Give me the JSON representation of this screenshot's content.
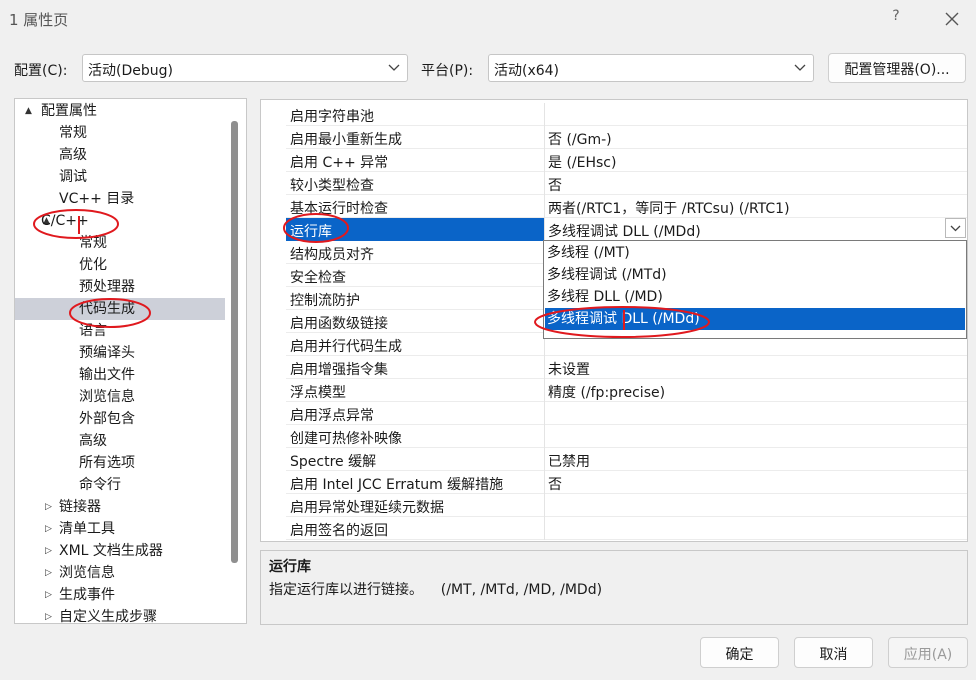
{
  "window": {
    "title": "1 属性页",
    "help": "?"
  },
  "config": {
    "label": "配置(C):",
    "value": "活动(Debug)"
  },
  "platform": {
    "label": "平台(P):",
    "value": "活动(x64)"
  },
  "config_manager_label": "配置管理器(O)...",
  "tree": [
    {
      "label": "配置属性",
      "expander": "▲"
    },
    {
      "label": "常规"
    },
    {
      "label": "高级"
    },
    {
      "label": "调试"
    },
    {
      "label": "VC++ 目录"
    },
    {
      "label": "C/C++",
      "expander": "▲"
    },
    {
      "label": "常规"
    },
    {
      "label": "优化"
    },
    {
      "label": "预处理器"
    },
    {
      "label": "代码生成",
      "selected": true
    },
    {
      "label": "语言"
    },
    {
      "label": "预编译头"
    },
    {
      "label": "输出文件"
    },
    {
      "label": "浏览信息"
    },
    {
      "label": "外部包含"
    },
    {
      "label": "高级"
    },
    {
      "label": "所有选项"
    },
    {
      "label": "命令行"
    },
    {
      "label": "链接器",
      "expander": "▷"
    },
    {
      "label": "清单工具",
      "expander": "▷"
    },
    {
      "label": "XML 文档生成器",
      "expander": "▷"
    },
    {
      "label": "浏览信息",
      "expander": "▷"
    },
    {
      "label": "生成事件",
      "expander": "▷"
    },
    {
      "label": "自定义生成步骤",
      "expander": "▷"
    }
  ],
  "properties": [
    {
      "name": "启用字符串池",
      "value": ""
    },
    {
      "name": "启用最小重新生成",
      "value": "否 (/Gm-)"
    },
    {
      "name": "启用 C++ 异常",
      "value": "是 (/EHsc)"
    },
    {
      "name": "较小类型检查",
      "value": "否"
    },
    {
      "name": "基本运行时检查",
      "value": "两者(/RTC1，等同于 /RTCsu) (/RTC1)"
    },
    {
      "name": "运行库",
      "value": "多线程调试 DLL (/MDd)",
      "selected": true
    },
    {
      "name": "结构成员对齐",
      "value": ""
    },
    {
      "name": "安全检查",
      "value": ""
    },
    {
      "name": "控制流防护",
      "value": ""
    },
    {
      "name": "启用函数级链接",
      "value": ""
    },
    {
      "name": "启用并行代码生成",
      "value": ""
    },
    {
      "name": "启用增强指令集",
      "value": "未设置"
    },
    {
      "name": "浮点模型",
      "value": "精度 (/fp:precise)"
    },
    {
      "name": "启用浮点异常",
      "value": ""
    },
    {
      "name": "创建可热修补映像",
      "value": ""
    },
    {
      "name": "Spectre 缓解",
      "value": "已禁用"
    },
    {
      "name": "启用 Intel JCC Erratum 缓解措施",
      "value": "否"
    },
    {
      "name": "启用异常处理延续元数据",
      "value": ""
    },
    {
      "name": "启用签名的返回",
      "value": ""
    }
  ],
  "dropdown": {
    "options": [
      "多线程 (/MT)",
      "多线程调试 (/MTd)",
      "多线程 DLL (/MD)",
      "多线程调试 DLL (/MDd)"
    ],
    "selected_index": 3
  },
  "description": {
    "title": "运行库",
    "text": "指定运行库以进行链接。    (/MT, /MTd, /MD, /MDd)"
  },
  "buttons": {
    "ok": "确定",
    "cancel": "取消",
    "apply": "应用(A)"
  },
  "colors": {
    "selection": "#0a64c8",
    "tree_selection": "#cdd0d9",
    "annotation": "#e0191e"
  }
}
